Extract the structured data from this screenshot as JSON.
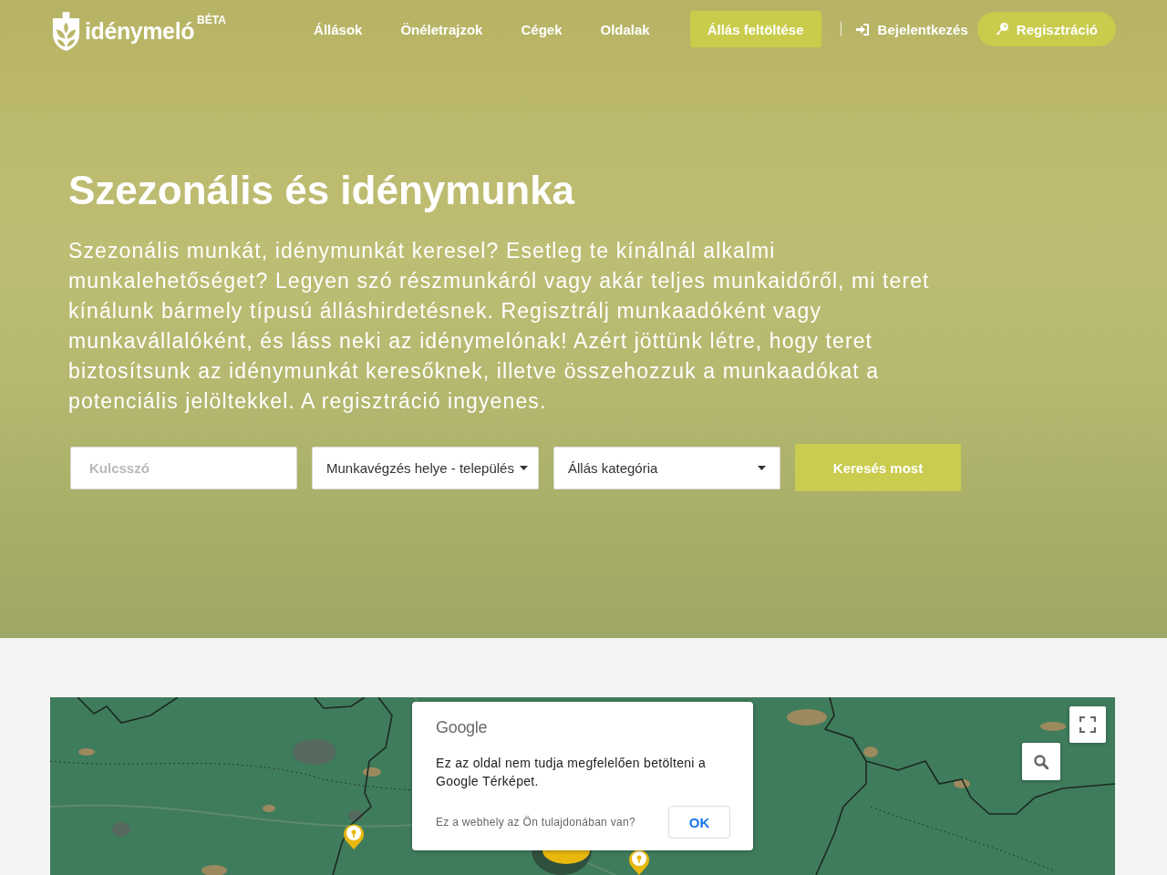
{
  "header": {
    "logo": {
      "name": "idénymeló",
      "badge": "BÉTA"
    },
    "nav": [
      {
        "label": "Állások"
      },
      {
        "label": "Önéletrajzok"
      },
      {
        "label": "Cégek"
      },
      {
        "label": "Oldalak"
      }
    ],
    "post_button": "Állás feltöltése",
    "login": "Bejelentkezés",
    "register": "Regisztráció"
  },
  "hero": {
    "title": "Szezonális és idénymunka",
    "text": "Szezonális munkát, idénymunkát keresel? Esetleg te kínálnál alkalmi munkalehetőséget? Legyen szó részmunkáról vagy akár teljes munkaidőről, mi teret kínálunk bármely típusú álláshirdetésnek. Regisztrálj munkaadóként vagy munkavállalóként, és láss neki az idénymelónak! Azért jöttünk létre, hogy teret biztosítsunk az idénymunkát keresőknek, illetve összehozzuk a munkaadókat a potenciális jelöltekkel. A regisztráció ingyenes.",
    "search": {
      "keyword": {
        "placeholder": "Kulcsszó"
      },
      "location": {
        "label": "Munkavégzés helye - település"
      },
      "category": {
        "label": "Állás kategória"
      },
      "button": "Keresés most"
    }
  },
  "map": {
    "dialog": {
      "brand": "Google",
      "message": "Ez az oldal nem tudja megfelelően betölteni a Google Térképet.",
      "question": "Ez a webhely az Ön tulajdonában van?",
      "button": "OK"
    }
  }
}
